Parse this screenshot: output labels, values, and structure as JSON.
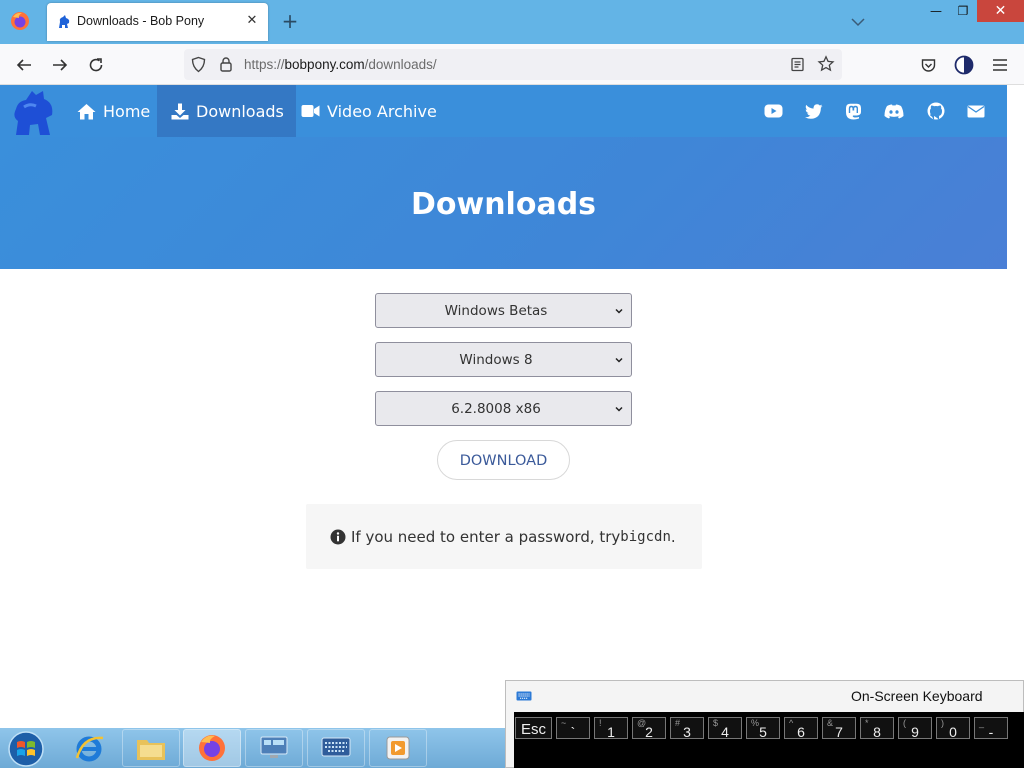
{
  "browser": {
    "tab": {
      "title": "Downloads - Bob Pony",
      "close_label": "✕"
    },
    "new_tab_label": "+",
    "url": {
      "scheme": "https://",
      "host": "bobpony.com",
      "path": "/downloads/"
    },
    "window_controls": {
      "minimize": "—",
      "maximize": "❐",
      "close": "✕"
    }
  },
  "site": {
    "nav": [
      {
        "label": "Home",
        "icon": "home-icon"
      },
      {
        "label": "Downloads",
        "icon": "download-icon",
        "active": true
      },
      {
        "label": "Video Archive",
        "icon": "video-icon"
      }
    ],
    "social_icons": [
      "youtube-icon",
      "twitter-icon",
      "mastodon-icon",
      "discord-icon",
      "github-icon",
      "email-icon"
    ],
    "hero_title": "Downloads",
    "selects": {
      "category": "Windows Betas",
      "version": "Windows 8",
      "build": "6.2.8008 x86"
    },
    "download_button": "DOWNLOAD",
    "note": {
      "text": "If you need to enter a password, try ",
      "password": "bigcdn",
      "suffix": "."
    },
    "colors": {
      "nav_bg": "#3a8fdb",
      "active_nav": "#3478c4",
      "button_text": "#3b5a9a"
    }
  },
  "taskbar": {
    "items": [
      "start-button",
      "internet-explorer-icon",
      "file-explorer-icon",
      "firefox-icon",
      "remote-desktop-icon",
      "on-screen-keyboard-icon",
      "media-player-icon"
    ]
  },
  "osk": {
    "title": "On-Screen Keyboard",
    "keys": [
      {
        "main": "Esc",
        "sub": ""
      },
      {
        "main": "`",
        "sub": "~"
      },
      {
        "main": "1",
        "sub": "!"
      },
      {
        "main": "2",
        "sub": "@"
      },
      {
        "main": "3",
        "sub": "#"
      },
      {
        "main": "4",
        "sub": "$"
      },
      {
        "main": "5",
        "sub": "%"
      },
      {
        "main": "6",
        "sub": "^"
      },
      {
        "main": "7",
        "sub": "&"
      },
      {
        "main": "8",
        "sub": "*"
      },
      {
        "main": "9",
        "sub": "("
      },
      {
        "main": "0",
        "sub": ")"
      },
      {
        "main": "-",
        "sub": "_"
      }
    ]
  }
}
